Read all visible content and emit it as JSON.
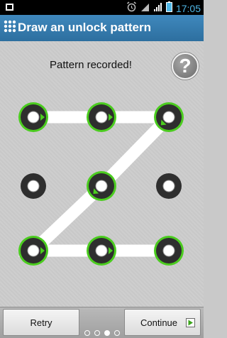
{
  "status_bar": {
    "time": "17:05",
    "icons": [
      "android-debug-icon",
      "alarm-clock-icon",
      "wifi-icon",
      "signal-icon",
      "battery-icon"
    ],
    "time_color": "#4fb8e8"
  },
  "header": {
    "title": "Draw an unlock pattern",
    "icon": "pattern-grid-icon",
    "color": "#3a80b5"
  },
  "main": {
    "message": "Pattern recorded!",
    "help_label": "?"
  },
  "pattern": {
    "grid": [
      [
        true,
        true,
        true
      ],
      [
        false,
        true,
        false
      ],
      [
        true,
        true,
        true
      ]
    ],
    "path": [
      1,
      2,
      3,
      5,
      7,
      8,
      9
    ],
    "active_color": "#4bcc1f"
  },
  "footer": {
    "retry_label": "Retry",
    "continue_label": "Continue",
    "pages": [
      {
        "active": false
      },
      {
        "active": false
      },
      {
        "active": true
      },
      {
        "active": false
      }
    ]
  }
}
